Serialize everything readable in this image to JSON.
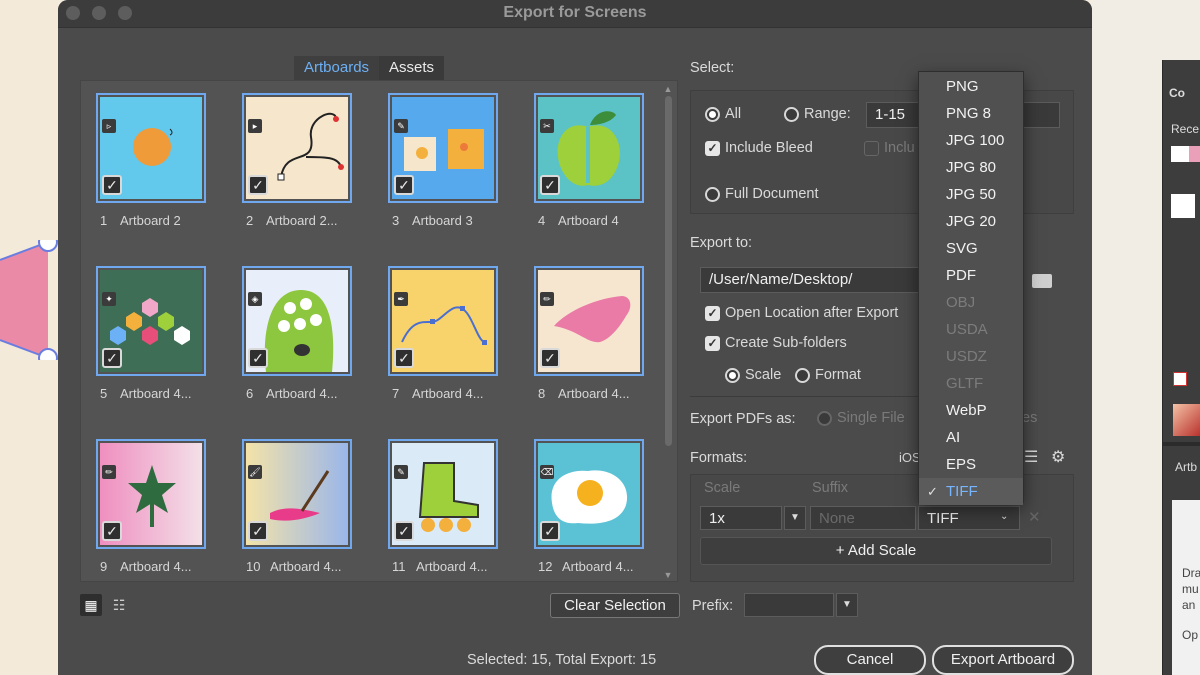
{
  "window": {
    "title": "Export for Screens"
  },
  "tabs": [
    {
      "label": "Artboards"
    },
    {
      "label": "Assets"
    }
  ],
  "artboards": [
    {
      "num": "1",
      "name": "Artboard 2"
    },
    {
      "num": "2",
      "name": "Artboard 2..."
    },
    {
      "num": "3",
      "name": "Artboard 3"
    },
    {
      "num": "4",
      "name": "Artboard 4"
    },
    {
      "num": "5",
      "name": "Artboard 4..."
    },
    {
      "num": "6",
      "name": "Artboard 4..."
    },
    {
      "num": "7",
      "name": "Artboard 4..."
    },
    {
      "num": "8",
      "name": "Artboard 4..."
    },
    {
      "num": "9",
      "name": "Artboard 4..."
    },
    {
      "num": "10",
      "name": "Artboard 4..."
    },
    {
      "num": "11",
      "name": "Artboard 4..."
    },
    {
      "num": "12",
      "name": "Artboard 4..."
    }
  ],
  "select": {
    "heading": "Select:",
    "all_label": "All",
    "range_label": "Range:",
    "range_value": "1-15",
    "include_bleed": "Include Bleed",
    "include_partial": "Inclu",
    "full_document": "Full Document"
  },
  "export": {
    "heading": "Export to:",
    "path": "/User/Name/Desktop/",
    "open_location": "Open Location after Export",
    "create_subfolders": "Create Sub-folders",
    "scale_label": "Scale",
    "format_label": "Format",
    "pdfs_as": "Export PDFs as:",
    "single_file": "Single File",
    "pdfs_tail": "es"
  },
  "formats": {
    "heading": "Formats:",
    "ios": "iOS",
    "col_scale": "Scale",
    "col_suffix": "Suffix",
    "scale_value": "1x",
    "suffix_placeholder": "None",
    "format_value": "TIFF",
    "add_scale": "Add Scale"
  },
  "format_menu": {
    "items": [
      "PNG",
      "PNG 8",
      "JPG 100",
      "JPG 80",
      "JPG 50",
      "JPG 20",
      "SVG",
      "PDF",
      "OBJ",
      "USDA",
      "USDZ",
      "GLTF",
      "WebP",
      "AI",
      "EPS",
      "TIFF"
    ],
    "disabled": [
      "OBJ",
      "USDA",
      "USDZ",
      "GLTF"
    ],
    "selected": "TIFF"
  },
  "footer": {
    "clear_selection": "Clear Selection",
    "prefix_label": "Prefix:",
    "status": "Selected: 15, Total Export: 15",
    "cancel": "Cancel",
    "export_artboard": "Export Artboard"
  },
  "right_panel": {
    "title": "Co",
    "recent": "Rece",
    "artboards": "Artb",
    "help1": "Dra",
    "help2": "mu",
    "help3": "an",
    "help4": "Op"
  },
  "colors": {
    "accent": "#6cb0f5",
    "dialog_bg": "#4b4b4b",
    "selection_border": "#6fa8ef"
  }
}
